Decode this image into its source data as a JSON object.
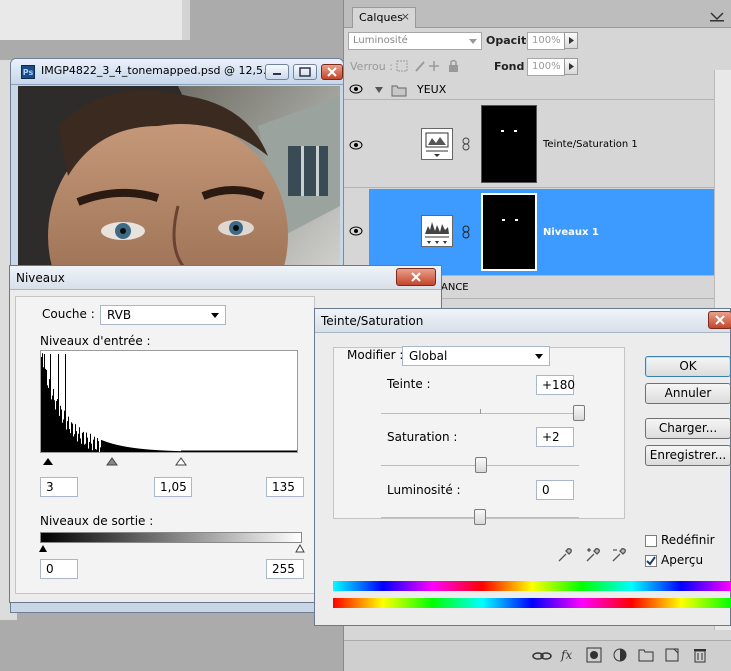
{
  "document": {
    "title": "IMGP4822_3_4_tonemapped.psd @ 12,5..."
  },
  "layers_panel": {
    "tab_label": "Calques",
    "tab_close": "×",
    "blend_mode": "Luminosité",
    "opacity_label": "Opacité :",
    "opacity_value": "100%",
    "lock_label": "Verrou :",
    "fill_label": "Fond :",
    "fill_value": "100%",
    "layers": [
      {
        "name": "YEUX",
        "type": "group"
      },
      {
        "name": "Teinte/Saturation 1",
        "type": "adjustment"
      },
      {
        "name": "Niveaux 1",
        "type": "adjustment",
        "selected": true
      },
      {
        "name": "ANCE",
        "type": "partial"
      }
    ],
    "accent_color": "#3d9bff"
  },
  "levels": {
    "title": "Niveaux",
    "channel_label": "Couche :",
    "channel_value": "RVB",
    "input_label": "Niveaux d'entrée :",
    "input_black": "3",
    "input_gamma": "1,05",
    "input_white": "135",
    "output_label": "Niveaux de sortie :",
    "output_black": "0",
    "output_white": "255"
  },
  "hue_sat": {
    "title": "Teinte/Saturation",
    "edit_label": "Modifier :",
    "edit_value": "Global",
    "hue_label": "Teinte :",
    "hue_value": "+180",
    "hue_slider_fraction": 1.0,
    "saturation_label": "Saturation :",
    "saturation_value": "+2",
    "saturation_slider_fraction": 0.505,
    "lightness_label": "Luminosité :",
    "lightness_value": "0",
    "lightness_slider_fraction": 0.5,
    "buttons": {
      "ok": "OK",
      "cancel": "Annuler",
      "load": "Charger...",
      "save": "Enregistrer..."
    },
    "colorize_label": "Redéfinir",
    "colorize_checked": false,
    "preview_label": "Aperçu",
    "preview_checked": true
  }
}
